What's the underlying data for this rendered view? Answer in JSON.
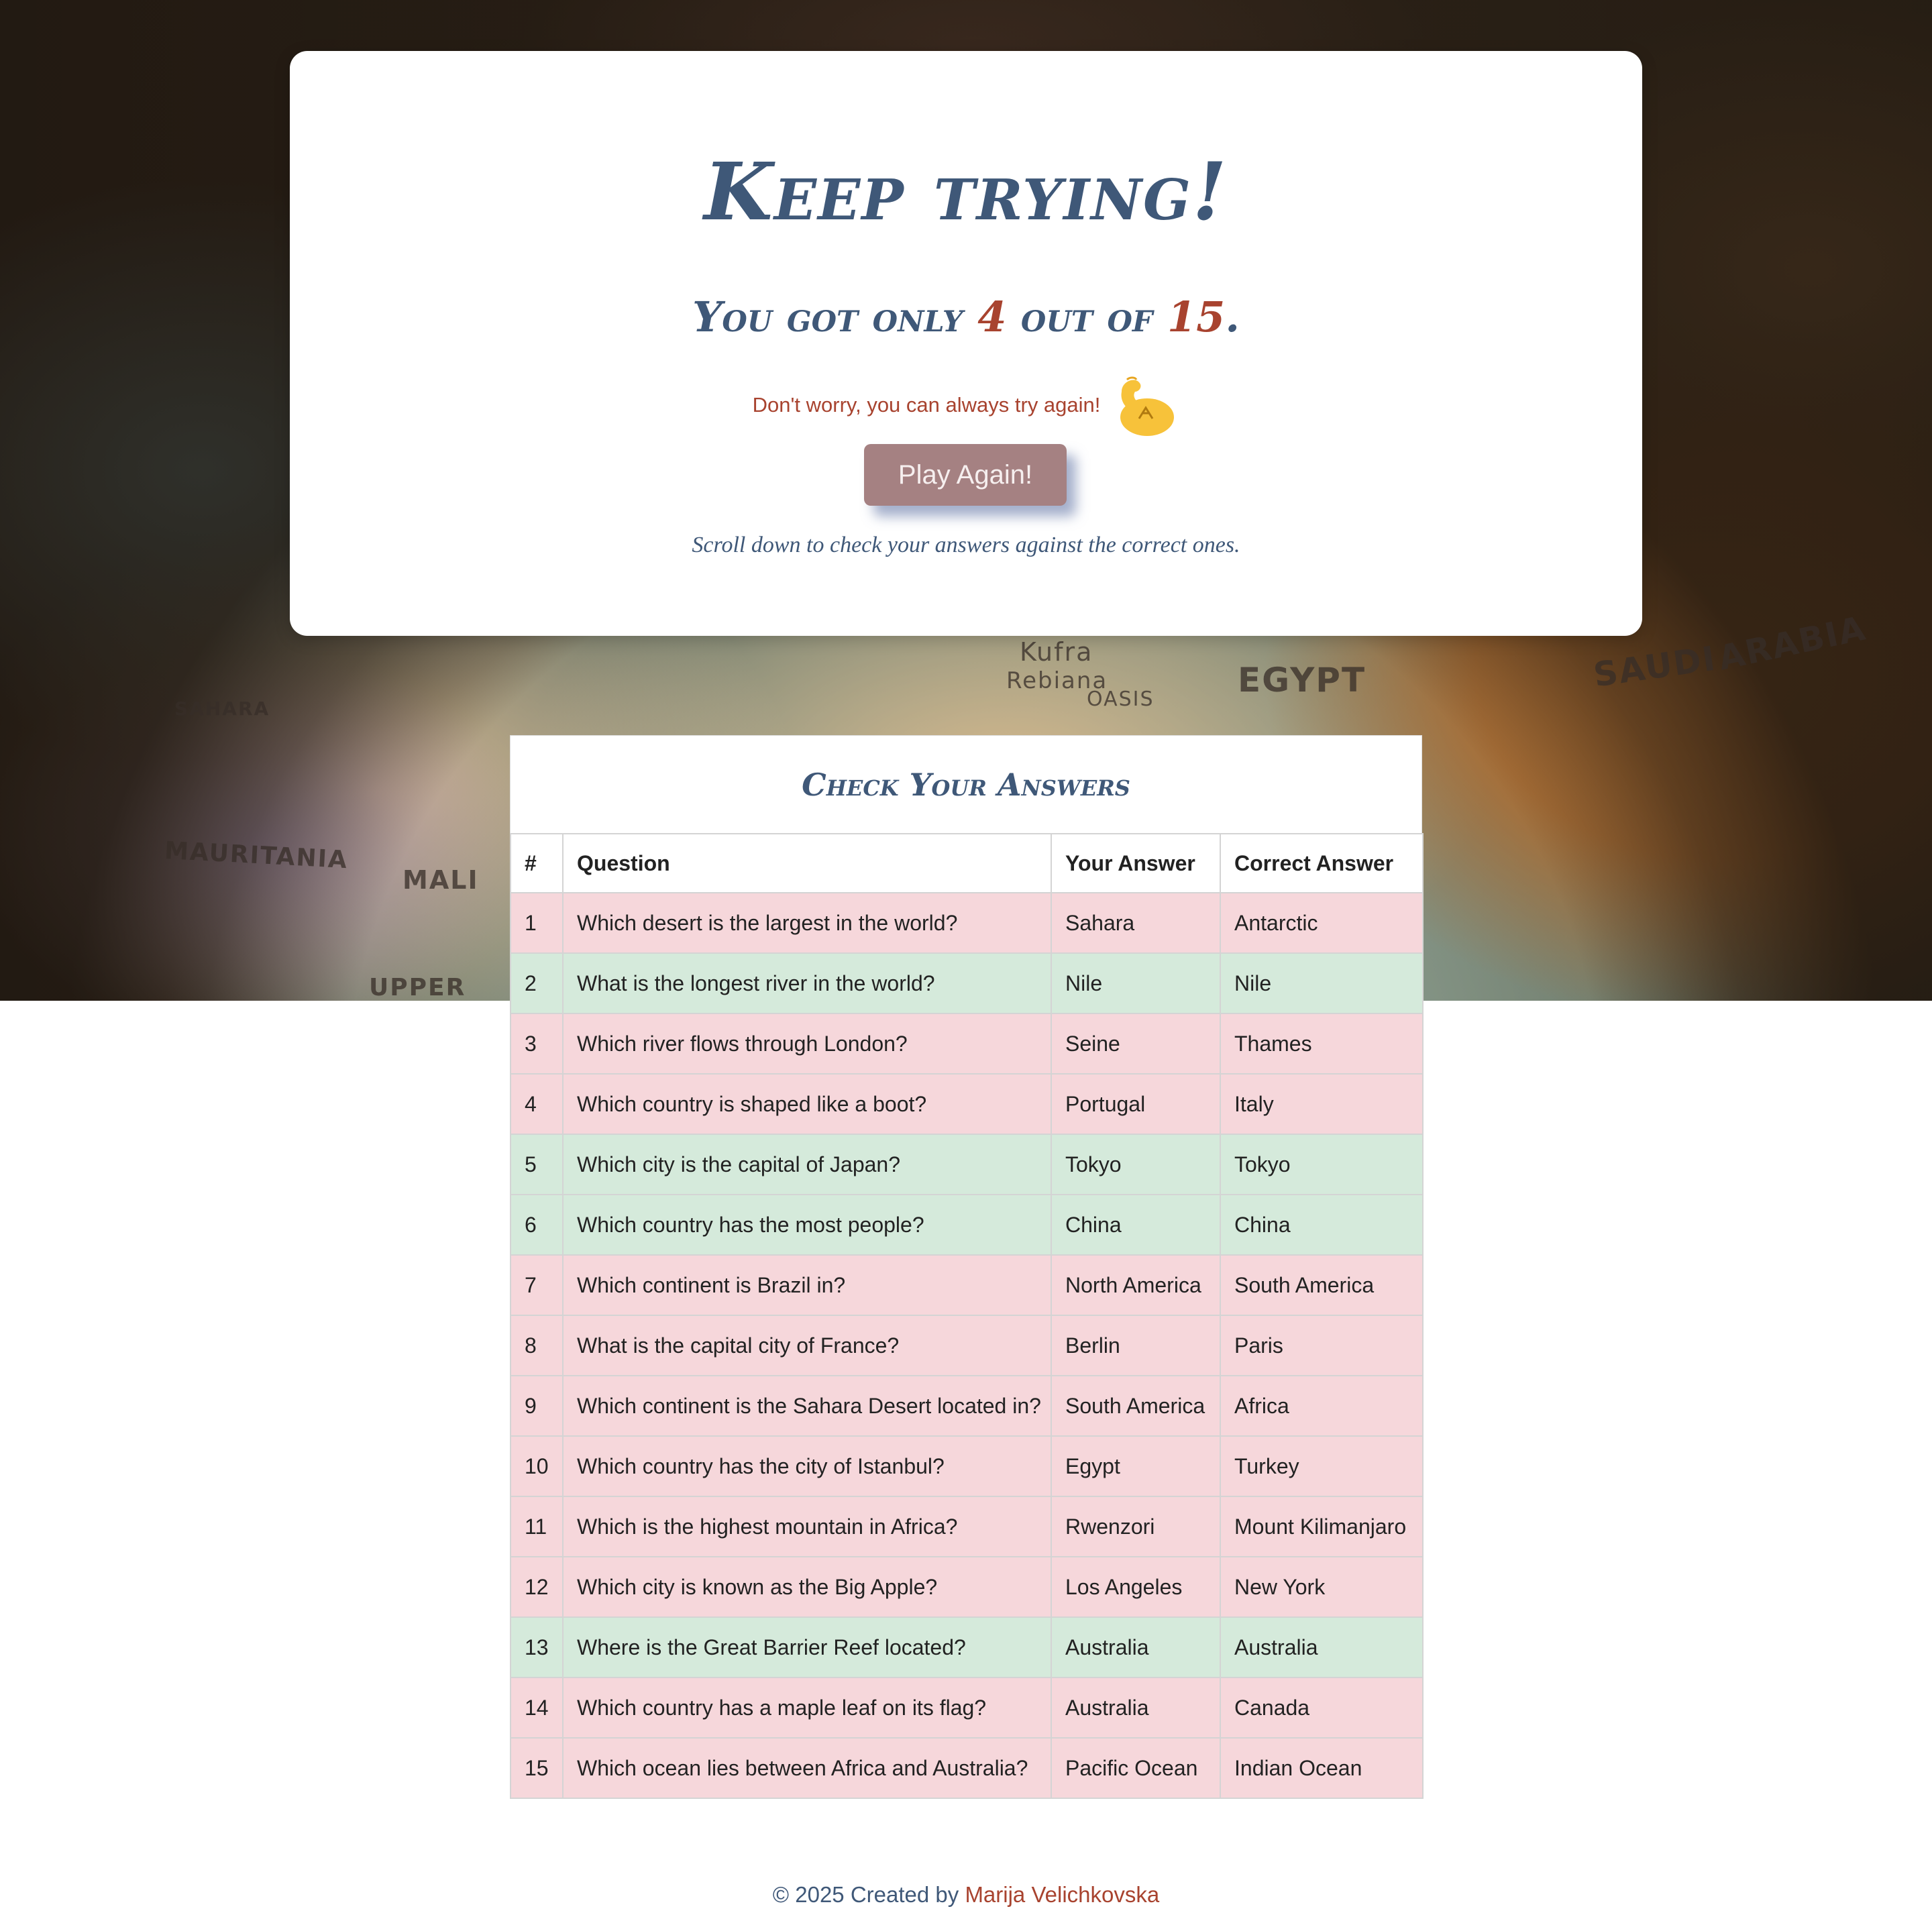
{
  "result": {
    "title": "Keep trying!",
    "score_prefix": "You got only",
    "score": "4",
    "score_middle": "out of",
    "total": "15",
    "score_suffix": ".",
    "encouragement": "Don't worry, you can always try again!",
    "encouragement_icon": "flexed-biceps-icon",
    "play_again_label": "Play Again!",
    "scroll_hint": "Scroll down to check your answers against the correct ones."
  },
  "background_map_labels": [
    "EGYPT",
    "SAUDI",
    "ARABIA",
    "MAURITANIA",
    "MALI",
    "SAHARA",
    "UPPER",
    "OASIS",
    "Kufra",
    "Rebiana"
  ],
  "answers": {
    "title": "Check Your Answers",
    "columns": [
      "#",
      "Question",
      "Your Answer",
      "Correct Answer"
    ],
    "rows": [
      {
        "n": "1",
        "question": "Which desert is the largest in the world?",
        "yours": "Sahara",
        "correct": "Antarctic",
        "status": "wrong"
      },
      {
        "n": "2",
        "question": "What is the longest river in the world?",
        "yours": "Nile",
        "correct": "Nile",
        "status": "right"
      },
      {
        "n": "3",
        "question": "Which river flows through London?",
        "yours": "Seine",
        "correct": "Thames",
        "status": "wrong"
      },
      {
        "n": "4",
        "question": "Which country is shaped like a boot?",
        "yours": "Portugal",
        "correct": "Italy",
        "status": "wrong"
      },
      {
        "n": "5",
        "question": "Which city is the capital of Japan?",
        "yours": "Tokyo",
        "correct": "Tokyo",
        "status": "right"
      },
      {
        "n": "6",
        "question": "Which country has the most people?",
        "yours": "China",
        "correct": "China",
        "status": "right"
      },
      {
        "n": "7",
        "question": "Which continent is Brazil in?",
        "yours": "North America",
        "correct": "South America",
        "status": "wrong"
      },
      {
        "n": "8",
        "question": "What is the capital city of France?",
        "yours": "Berlin",
        "correct": "Paris",
        "status": "wrong"
      },
      {
        "n": "9",
        "question": "Which continent is the Sahara Desert located in?",
        "yours": "South America",
        "correct": "Africa",
        "status": "wrong"
      },
      {
        "n": "10",
        "question": "Which country has the city of Istanbul?",
        "yours": "Egypt",
        "correct": "Turkey",
        "status": "wrong"
      },
      {
        "n": "11",
        "question": "Which is the highest mountain in Africa?",
        "yours": "Rwenzori",
        "correct": "Mount Kilimanjaro",
        "status": "wrong"
      },
      {
        "n": "12",
        "question": "Which city is known as the Big Apple?",
        "yours": "Los Angeles",
        "correct": "New York",
        "status": "wrong"
      },
      {
        "n": "13",
        "question": "Where is the Great Barrier Reef located?",
        "yours": "Australia",
        "correct": "Australia",
        "status": "right"
      },
      {
        "n": "14",
        "question": "Which country has a maple leaf on its flag?",
        "yours": "Australia",
        "correct": "Canada",
        "status": "wrong"
      },
      {
        "n": "15",
        "question": "Which ocean lies between Africa and Australia?",
        "yours": "Pacific Ocean",
        "correct": "Indian Ocean",
        "status": "wrong"
      }
    ]
  },
  "footer": {
    "prefix": "© 2025 Created by",
    "author": "Marija Velichkovska"
  },
  "colors": {
    "heading_blue": "#3f5878",
    "accent_red": "#a8432f",
    "button_bg": "#a58182",
    "row_wrong": "#f6d7db",
    "row_right": "#d5eadb"
  }
}
